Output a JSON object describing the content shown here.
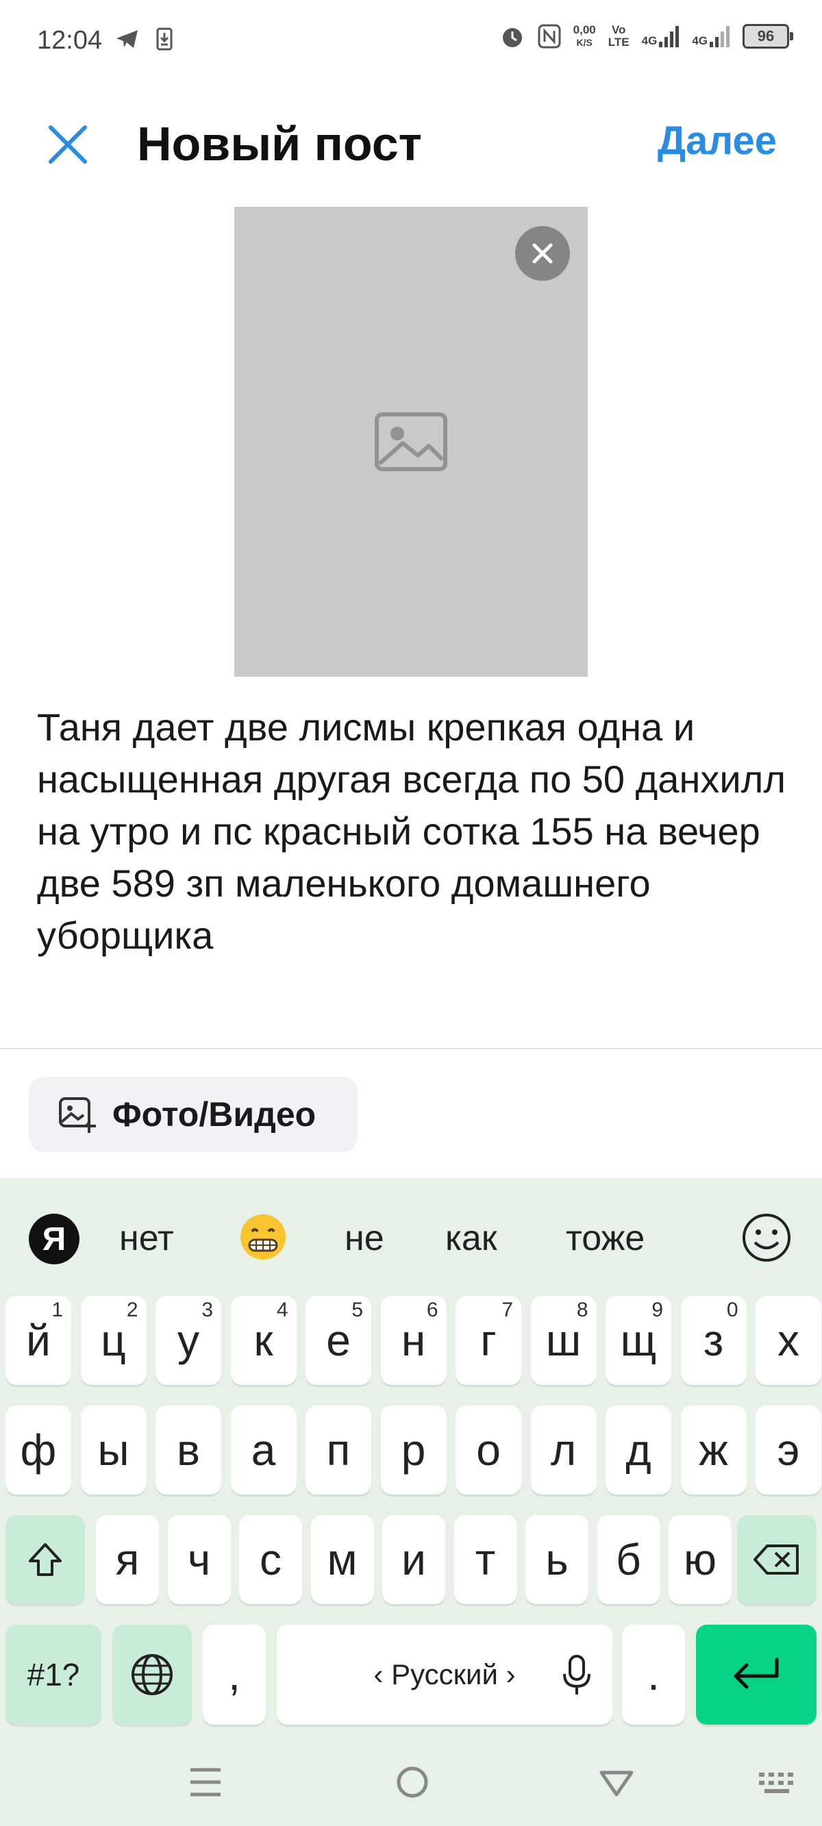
{
  "status_bar": {
    "time": "12:04",
    "net_speed_top": "0,00",
    "net_speed_bottom": "K/S",
    "volte_top": "Vo",
    "volte_bottom": "LTE",
    "signal1_label": "4G",
    "signal2_label": "4G",
    "battery": "96",
    "icons": [
      "telegram-icon",
      "download-icon",
      "alarm-icon",
      "nfc-icon",
      "signal-icon",
      "battery-icon"
    ]
  },
  "header": {
    "title": "Новый пост",
    "next_label": "Далее",
    "accent_color": "#2a8ddf"
  },
  "post": {
    "caption": "Таня дает две лисмы крепкая одна и насыщенная другая всегда по 50 данхилл на утро и пс красный сотка 155 на вечер две 589 зп маленького домашнего уборщика"
  },
  "media_button": {
    "label": "Фото/Видео"
  },
  "keyboard": {
    "logo": "Я",
    "suggestions": [
      "нет",
      "не",
      "как",
      "тоже"
    ],
    "row1": [
      {
        "k": "й",
        "h": "1"
      },
      {
        "k": "ц",
        "h": "2"
      },
      {
        "k": "у",
        "h": "3"
      },
      {
        "k": "к",
        "h": "4"
      },
      {
        "k": "е",
        "h": "5"
      },
      {
        "k": "н",
        "h": "6"
      },
      {
        "k": "г",
        "h": "7"
      },
      {
        "k": "ш",
        "h": "8"
      },
      {
        "k": "щ",
        "h": "9"
      },
      {
        "k": "з",
        "h": "0"
      },
      {
        "k": "х",
        "h": ""
      }
    ],
    "row2": [
      "ф",
      "ы",
      "в",
      "а",
      "п",
      "р",
      "о",
      "л",
      "д",
      "ж",
      "э"
    ],
    "row3": [
      "я",
      "ч",
      "с",
      "м",
      "и",
      "т",
      "ь",
      "б",
      "ю"
    ],
    "symbols_label": "#1?",
    "comma": ",",
    "space_label": "‹ Русский ›",
    "period": ".",
    "colors": {
      "background": "#e7f1e7",
      "func_key": "#c8ecd7",
      "enter_key": "#06d484"
    }
  }
}
